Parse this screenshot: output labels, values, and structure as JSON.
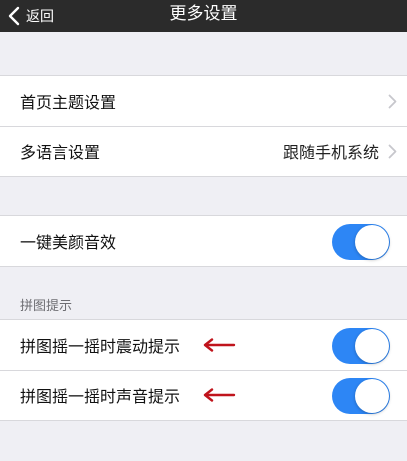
{
  "navbar": {
    "back_label": "返回",
    "title": "更多设置"
  },
  "group1": {
    "home_theme_label": "首页主题设置",
    "language_label": "多语言设置",
    "language_value": "跟随手机系统"
  },
  "group2": {
    "beauty_sound_label": "一键美颜音效",
    "beauty_sound_on": true
  },
  "puzzle_section": {
    "header": "拼图提示",
    "vibrate_label": "拼图摇一摇时震动提示",
    "vibrate_on": true,
    "sound_label": "拼图摇一摇时声音提示",
    "sound_on": true
  },
  "colors": {
    "navbar_bg": "#2b2b2b",
    "toggle_on": "#2d86f5",
    "annotation_arrow": "#c0141c",
    "page_bg": "#efeff4"
  },
  "icons": {
    "back": "chevron-left-icon",
    "disclosure": "chevron-right-icon",
    "annotation": "red-arrow-icon"
  }
}
